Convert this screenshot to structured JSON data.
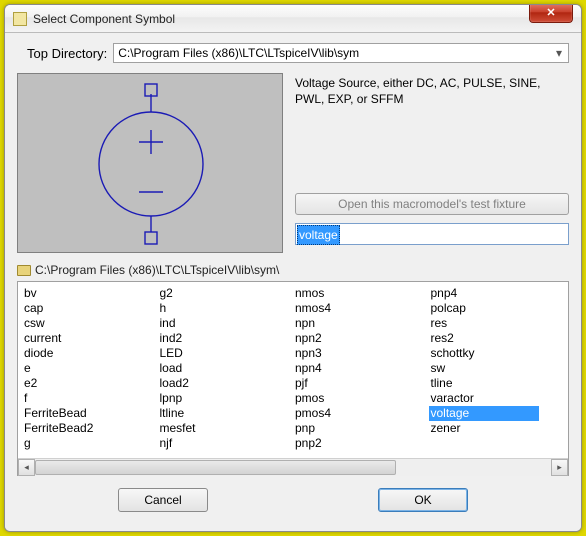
{
  "window": {
    "title": "Select Component Symbol",
    "close_glyph": "✕"
  },
  "top": {
    "label": "Top Directory:",
    "path": "C:\\Program Files (x86)\\LTC\\LTspiceIV\\lib\\sym",
    "arrow": "▾"
  },
  "description": "Voltage Source, either DC, AC, PULSE, SINE, PWL, EXP, or SFFM",
  "test_fixture_btn": "Open this macromodel's test fixture",
  "search": {
    "value": "voltage"
  },
  "path_row": "C:\\Program Files (x86)\\LTC\\LTspiceIV\\lib\\sym\\",
  "columns": [
    [
      "bv",
      "cap",
      "csw",
      "current",
      "diode",
      "e",
      "e2",
      "f",
      "FerriteBead",
      "FerriteBead2",
      "g"
    ],
    [
      "g2",
      "h",
      "ind",
      "ind2",
      "LED",
      "load",
      "load2",
      "lpnp",
      "ltline",
      "mesfet",
      "njf"
    ],
    [
      "nmos",
      "nmos4",
      "npn",
      "npn2",
      "npn3",
      "npn4",
      "pjf",
      "pmos",
      "pmos4",
      "pnp",
      "pnp2"
    ],
    [
      "pnp4",
      "polcap",
      "res",
      "res2",
      "schottky",
      "sw",
      "tline",
      "varactor",
      "voltage",
      "zener"
    ]
  ],
  "selected_item": "voltage",
  "hscroll": {
    "left": "◂",
    "right": "▸"
  },
  "buttons": {
    "cancel": "Cancel",
    "ok": "OK"
  }
}
